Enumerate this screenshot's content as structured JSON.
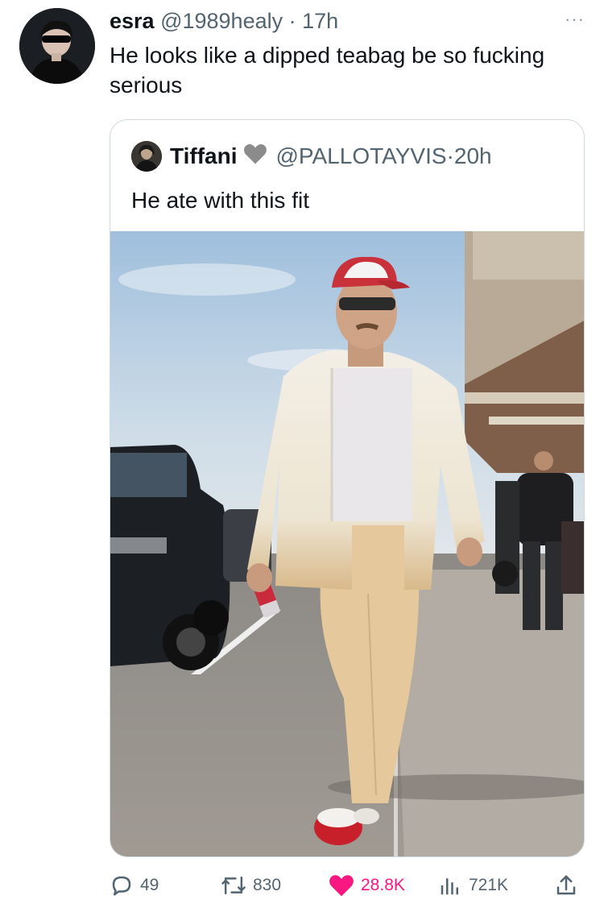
{
  "tweet": {
    "display_name": "esra",
    "handle": "@1989healy",
    "separator": "·",
    "time": "17h",
    "text": "He looks like a dipped teabag be so fucking serious",
    "more_label": "···"
  },
  "quote": {
    "display_name": "Tiffani",
    "handle": "@PALLOTAYVIS",
    "separator": "·",
    "time": "20h",
    "text": "He ate with this fit",
    "name_icon": "grey-heart-icon",
    "photo_icon": "photo-man-walking"
  },
  "actions": {
    "replies": "49",
    "retweets": "830",
    "likes": "28.8K",
    "views": "721K"
  },
  "colors": {
    "like_pink": "#f91880",
    "muted_gray": "#536471",
    "border": "#cfd9de"
  }
}
